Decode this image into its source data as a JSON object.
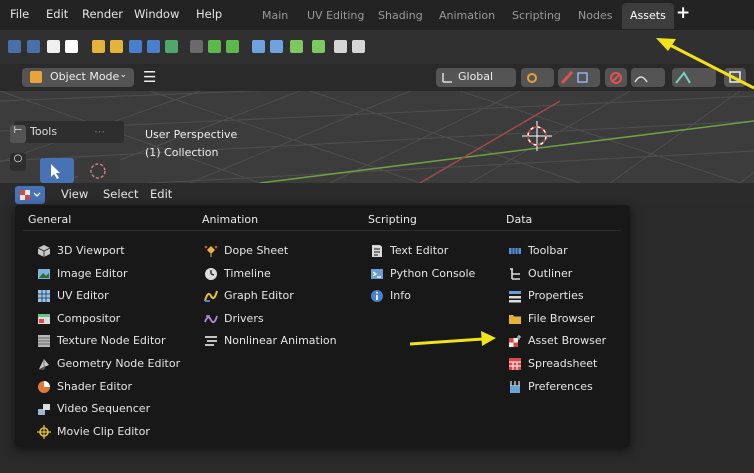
{
  "menubar": {
    "items": [
      "File",
      "Edit",
      "Render",
      "Window",
      "Help"
    ],
    "workspaces": [
      "Main",
      "UV Editing",
      "Shading",
      "Animation",
      "Scripting",
      "Nodes",
      "Assets"
    ],
    "active_workspace": "Assets",
    "add_workspace": "+"
  },
  "viewport_header": {
    "mode": "Object Mode",
    "mode_chevron": "⌄",
    "menu": "☰",
    "transform_orientation": "Global"
  },
  "viewport": {
    "tools_label": "Tools",
    "view_name": "User Perspective",
    "collection": "(1) Collection"
  },
  "editor_header": {
    "menus": [
      "View",
      "Select",
      "Edit"
    ]
  },
  "popup": {
    "columns": [
      {
        "heading": "General",
        "items": [
          {
            "label": "3D Viewport",
            "icon": "viewport-3d-icon",
            "color": "#c7c7c7"
          },
          {
            "label": "Image Editor",
            "icon": "image-editor-icon",
            "color": "#7fb0d8"
          },
          {
            "label": "UV Editor",
            "icon": "uv-editor-icon",
            "color": "#9ec6e8"
          },
          {
            "label": "Compositor",
            "icon": "compositor-icon",
            "color": "#6bc38a"
          },
          {
            "label": "Texture Node Editor",
            "icon": "texture-node-icon",
            "color": "#b5b5b5"
          },
          {
            "label": "Geometry Node Editor",
            "icon": "geometry-node-icon",
            "color": "#c9c9c9"
          },
          {
            "label": "Shader Editor",
            "icon": "shader-editor-icon",
            "color": "#e07a3a"
          },
          {
            "label": "Video Sequencer",
            "icon": "video-sequencer-icon",
            "color": "#9ab8d6"
          },
          {
            "label": "Movie Clip Editor",
            "icon": "movie-clip-icon",
            "color": "#e0c23a"
          }
        ]
      },
      {
        "heading": "Animation",
        "items": [
          {
            "label": "Dope Sheet",
            "icon": "dope-sheet-icon",
            "color": "#e7b640"
          },
          {
            "label": "Timeline",
            "icon": "timeline-icon",
            "color": "#dcdcdc"
          },
          {
            "label": "Graph Editor",
            "icon": "graph-editor-icon",
            "color": "#e6c23c"
          },
          {
            "label": "Drivers",
            "icon": "drivers-icon",
            "color": "#b58ad6"
          },
          {
            "label": "Nonlinear Animation",
            "icon": "nla-icon",
            "color": "#dcdcdc"
          }
        ]
      },
      {
        "heading": "Scripting",
        "items": [
          {
            "label": "Text Editor",
            "icon": "text-editor-icon",
            "color": "#d9d9d9"
          },
          {
            "label": "Python Console",
            "icon": "python-console-icon",
            "color": "#6a9ed2"
          },
          {
            "label": "Info",
            "icon": "info-icon",
            "color": "#4c7fd0"
          }
        ]
      },
      {
        "heading": "Data",
        "items": [
          {
            "label": "Toolbar",
            "icon": "toolbar-icon",
            "color": "#5a8fd8"
          },
          {
            "label": "Outliner",
            "icon": "outliner-icon",
            "color": "#dddddd"
          },
          {
            "label": "Properties",
            "icon": "properties-icon",
            "color": "#6a9ed2"
          },
          {
            "label": "File Browser",
            "icon": "file-browser-icon",
            "color": "#e4b43a"
          },
          {
            "label": "Asset Browser",
            "icon": "asset-browser-icon",
            "color": "#d14848"
          },
          {
            "label": "Spreadsheet",
            "icon": "spreadsheet-icon",
            "color": "#d94b4b"
          },
          {
            "label": "Preferences",
            "icon": "preferences-icon",
            "color": "#6da3d6"
          }
        ]
      }
    ]
  },
  "annotation_color": "#f2e21a"
}
